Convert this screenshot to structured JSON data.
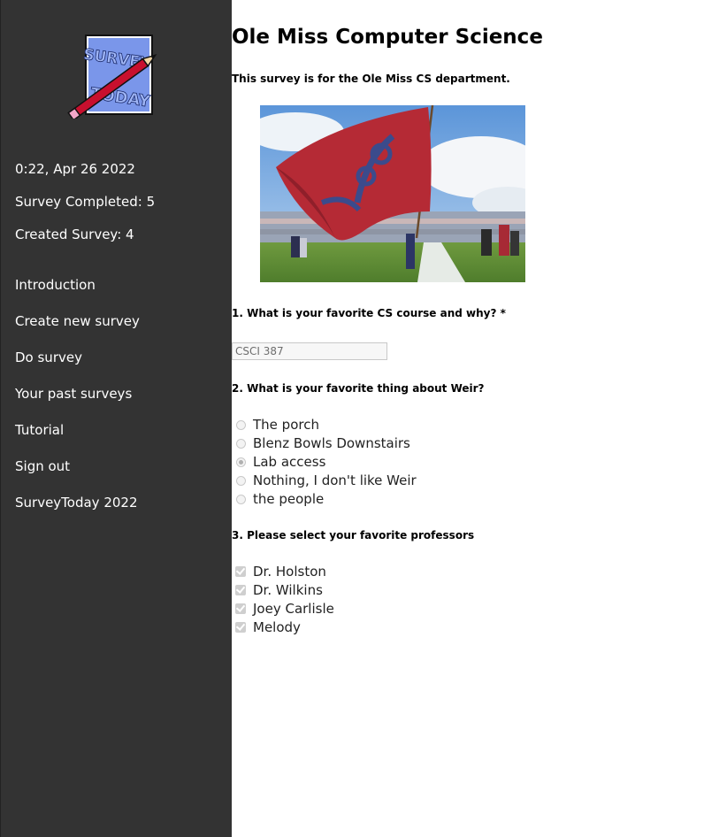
{
  "sidebar": {
    "logo_icon": "survey-today-logo-icon",
    "logo_lines": [
      "SURVEY",
      "TODAY"
    ],
    "datetime": "0:22, Apr 26 2022",
    "survey_completed": "Survey Completed: 5",
    "created_survey": "Created Survey: 4",
    "nav": [
      {
        "label": "Introduction"
      },
      {
        "label": "Create new survey"
      },
      {
        "label": "Do survey"
      },
      {
        "label": "Your past surveys"
      },
      {
        "label": "Tutorial"
      },
      {
        "label": "Sign out"
      },
      {
        "label": "SurveyToday 2022"
      }
    ]
  },
  "main": {
    "title": "Ole Miss Computer Science",
    "description": "This survey is for the Ole Miss CS department.",
    "hero_icon": "ole-miss-flag-photo",
    "questions": [
      {
        "label": "1. What is your favorite CS course and why? *",
        "value": "CSCI 387"
      },
      {
        "label": "2. What is your favorite thing about Weir?",
        "options": [
          "The porch",
          "Blenz Bowls Downstairs",
          "Lab access",
          "Nothing, I don't like Weir",
          "the people"
        ],
        "selected": "Lab access"
      },
      {
        "label": "3. Please select your favorite professors",
        "options": [
          "Dr. Holston",
          "Dr. Wilkins",
          "Joey Carlisle",
          "Melody"
        ],
        "checked": [
          "Dr. Holston",
          "Dr. Wilkins",
          "Joey Carlisle",
          "Melody"
        ]
      }
    ]
  },
  "colors": {
    "sidebar_bg": "#333333",
    "flag_red": "#b52a35",
    "flag_blue": "#3b4b8c",
    "logo_blue": "#6f8de6",
    "pencil_red": "#c8102e"
  }
}
